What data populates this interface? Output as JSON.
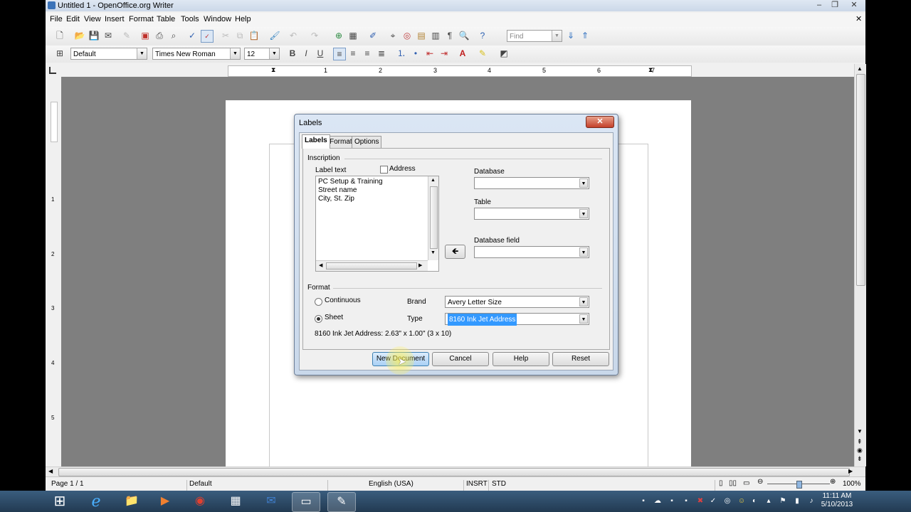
{
  "window": {
    "title": "Untitled 1 - OpenOffice.org Writer",
    "controls": {
      "minimize": "–",
      "maximize": "❐",
      "close": "✕"
    },
    "doc_close": "✕"
  },
  "menu": [
    "File",
    "Edit",
    "View",
    "Insert",
    "Format",
    "Table",
    "Tools",
    "Window",
    "Help"
  ],
  "toolbar": {
    "find_placeholder": "Find",
    "style_value": "Default",
    "font_value": "Times New Roman",
    "size_value": "12",
    "bold": "B",
    "italic": "I",
    "underline": "U"
  },
  "ruler": {
    "h_numbers": [
      "1",
      "2",
      "3",
      "4",
      "5",
      "6",
      "7"
    ],
    "v_numbers": [
      "1",
      "2",
      "3",
      "4",
      "5"
    ]
  },
  "dialog": {
    "title": "Labels",
    "close": "✕",
    "tabs": [
      "Labels",
      "Format",
      "Options"
    ],
    "active_tab": "Labels",
    "inscription_label": "Inscription",
    "label_text_label": "Label text",
    "address_label": "Address",
    "address_checked": false,
    "label_text_lines": [
      "PC Setup & Training",
      "Street name",
      "City, St. Zip"
    ],
    "database_label": "Database",
    "database_value": "",
    "table_label": "Table",
    "table_value": "",
    "database_field_label": "Database field",
    "database_field_value": "",
    "arrow_button": "🡸",
    "format_label": "Format",
    "continuous_label": "Continuous",
    "sheet_label": "Sheet",
    "selected_format": "Sheet",
    "brand_label": "Brand",
    "brand_value": "Avery Letter Size",
    "type_label": "Type",
    "type_value": "8160 Ink Jet Address",
    "info_text": "8160 Ink Jet Address: 2.63\" x 1.00\" (3 x 10)",
    "buttons": {
      "new_document": "New Document",
      "cancel": "Cancel",
      "help": "Help",
      "reset": "Reset"
    }
  },
  "statusbar": {
    "page": "Page 1 / 1",
    "style": "Default",
    "language": "English (USA)",
    "insert_mode": "INSRT",
    "selection_mode": "STD",
    "zoom": "100%"
  },
  "taskbar": {
    "time": "11:11 AM",
    "date": "5/10/2013"
  },
  "colors": {
    "selection": "#3399ff",
    "default_button": "#a9d0f5",
    "close_button": "#c4402a",
    "taskbar": "#2a4866"
  }
}
